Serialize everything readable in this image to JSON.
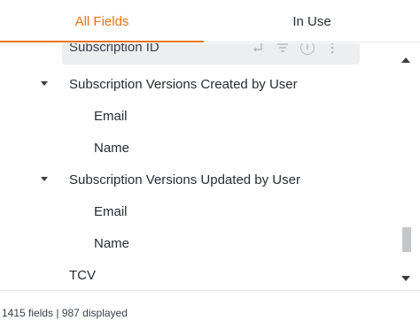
{
  "tabs": {
    "all_fields": "All Fields",
    "in_use": "In Use",
    "accent_color": "#e8730e"
  },
  "list": {
    "hover_row": {
      "label": "Subscription ID",
      "icons": [
        "pivot-icon",
        "filter-icon",
        "info-icon",
        "more-icon"
      ]
    },
    "items": [
      {
        "label": "Subscription Versions Created by User",
        "expandable": true,
        "expanded": true
      },
      {
        "label": "Email",
        "expandable": false
      },
      {
        "label": "Name",
        "expandable": false
      },
      {
        "label": "Subscription Versions Updated by User",
        "expandable": true,
        "expanded": true
      },
      {
        "label": "Email",
        "expandable": false
      },
      {
        "label": "Name",
        "expandable": false
      },
      {
        "label": "TCV",
        "expandable": false
      }
    ]
  },
  "footer": {
    "summary": "1415 fields | 987 displayed"
  }
}
